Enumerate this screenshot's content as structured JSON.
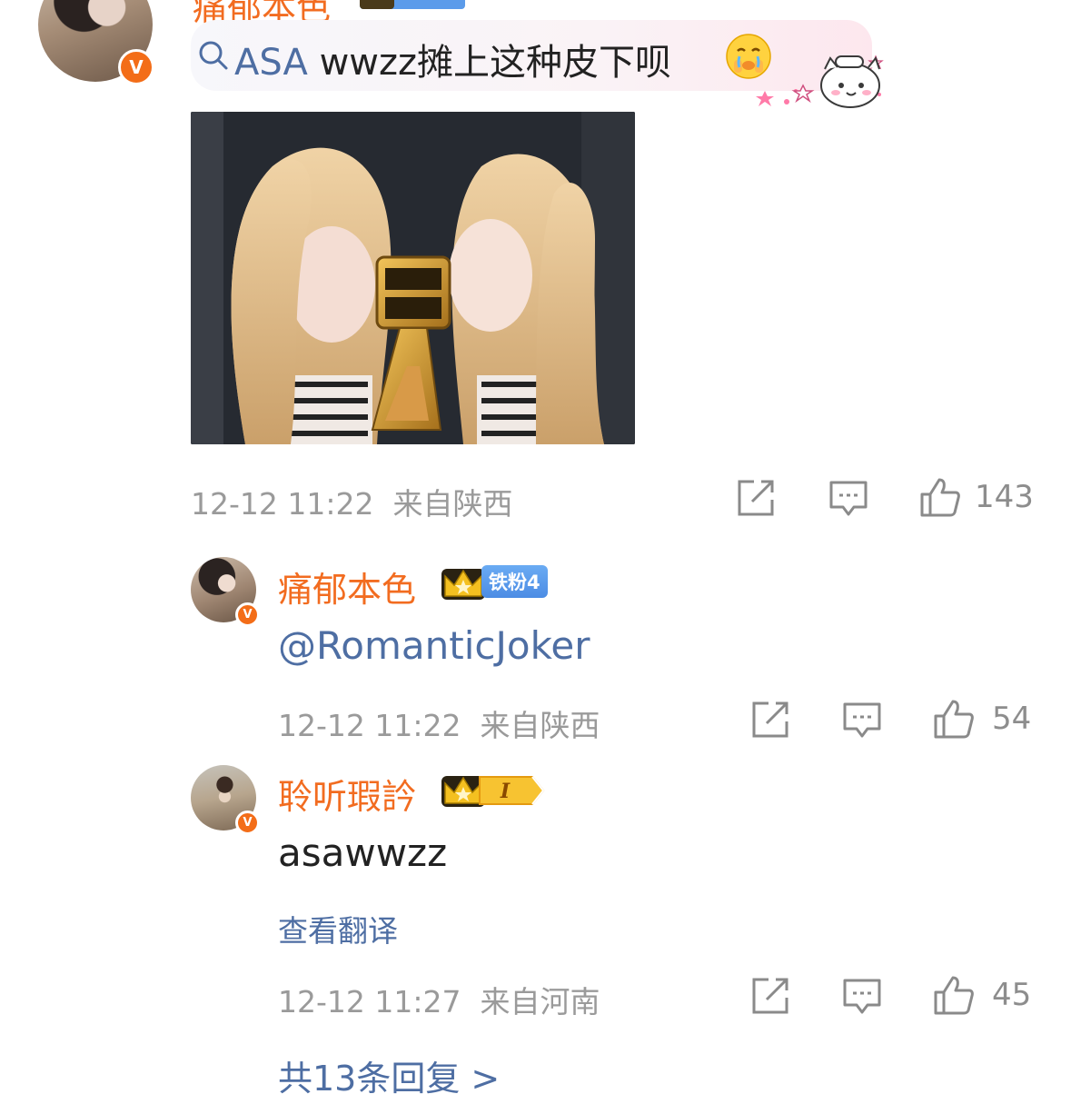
{
  "post": {
    "author_name": "痛郁本色",
    "search_suggestion": {
      "highlight": "ASA",
      "rest": " wwzz摊上这种皮下呗"
    },
    "emoji": "crying-emoji",
    "sticker": "cat-chef-sticker",
    "photo_alt": "award-photo",
    "timestamp": "12-12 11:22",
    "location": "来自陕西",
    "likes": "143"
  },
  "replies": [
    {
      "author_name": "痛郁本色",
      "fan_badge": "铁粉4",
      "text": "@RomanticJoker",
      "timestamp": "12-12 11:22",
      "location": "来自陕西",
      "likes": "54"
    },
    {
      "author_name": "聆听瑕訡",
      "level_badge": "I",
      "text": "asawwzz",
      "translate_label": "查看翻译",
      "timestamp": "12-12 11:27",
      "location": "来自河南",
      "likes": "45"
    }
  ],
  "more_replies_label": "共13条回复 >",
  "colors": {
    "name_orange": "#f26c20",
    "link_blue": "#4e6ea3",
    "meta_gray": "#9a9a9a",
    "fan_blue": "#5b9bea",
    "verify_orange": "#f36d18"
  }
}
